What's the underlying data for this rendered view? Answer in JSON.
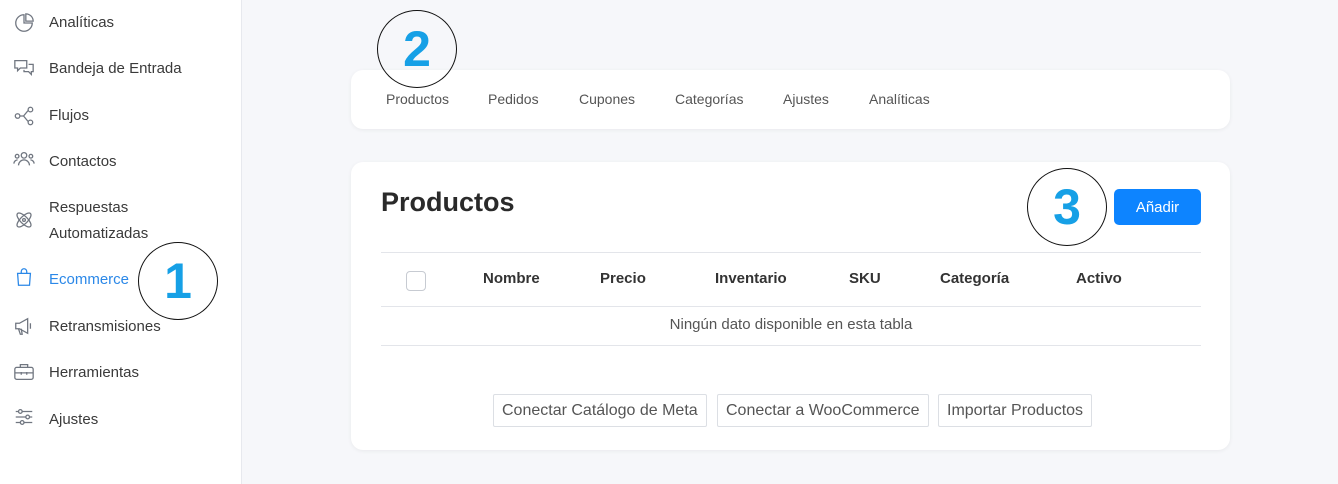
{
  "sidebar": {
    "items": [
      {
        "label": "Analíticas",
        "icon": "pie-chart-icon"
      },
      {
        "label": "Bandeja de Entrada",
        "icon": "chat-bubbles-icon"
      },
      {
        "label": "Flujos",
        "icon": "flow-nodes-icon"
      },
      {
        "label": "Contactos",
        "icon": "users-icon"
      },
      {
        "label": "Respuestas",
        "label2": "Automatizadas",
        "icon": "atom-icon"
      },
      {
        "label": "Ecommerce",
        "icon": "shopping-bag-icon",
        "active": true
      },
      {
        "label": "Retransmisiones",
        "icon": "megaphone-icon"
      },
      {
        "label": "Herramientas",
        "icon": "toolbox-icon"
      },
      {
        "label": "Ajustes",
        "icon": "sliders-icon"
      }
    ]
  },
  "tabs": [
    "Productos",
    "Pedidos",
    "Cupones",
    "Categorías",
    "Ajustes",
    "Analíticas"
  ],
  "products": {
    "title": "Productos",
    "add_label": "Añadir",
    "columns": [
      "Nombre",
      "Precio",
      "Inventario",
      "SKU",
      "Categoría",
      "Activo"
    ],
    "empty_message": "Ningún dato disponible en esta tabla",
    "actions": [
      "Conectar Catálogo de Meta",
      "Conectar a WooCommerce",
      "Importar Productos"
    ]
  },
  "markers": [
    "1",
    "2",
    "3"
  ],
  "colors": {
    "accent": "#2b88e8",
    "button": "#0d84ff",
    "marker": "#16a0e6"
  }
}
